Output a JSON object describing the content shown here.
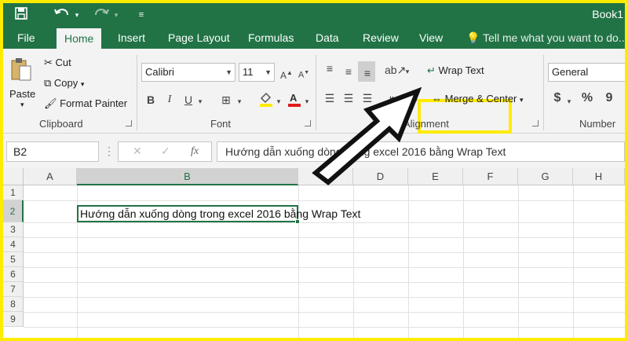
{
  "app": {
    "book_title": "Book1"
  },
  "qat": {
    "save": "save-icon",
    "undo": "undo-icon",
    "redo": "redo-icon",
    "customize": "customize-icon"
  },
  "tabs": [
    "File",
    "Home",
    "Insert",
    "Page Layout",
    "Formulas",
    "Data",
    "Review",
    "View"
  ],
  "tellme": "Tell me what you want to do...",
  "clipboard": {
    "paste": "Paste",
    "cut": "Cut",
    "copy": "Copy",
    "format_painter": "Format Painter",
    "label": "Clipboard"
  },
  "font": {
    "name": "Calibri",
    "size": "11",
    "label": "Font",
    "bold": "B",
    "italic": "I",
    "underline": "U",
    "fill_icon": "fill-color-icon",
    "font_color_icon": "font-color-icon",
    "borders_icon": "borders-icon"
  },
  "alignment": {
    "wrap_text": "Wrap Text",
    "merge_center": "Merge & Center",
    "label": "Alignment"
  },
  "number": {
    "format": "General",
    "label": "Number",
    "currency": "$",
    "percent": "%",
    "comma": "9"
  },
  "formula_bar": {
    "name_box": "B2",
    "fx": "fx",
    "content": "Hướng dẫn xuống dòng trong excel 2016 bằng Wrap Text"
  },
  "grid": {
    "columns": [
      "A",
      "B",
      "C",
      "D",
      "E",
      "F",
      "G",
      "H"
    ],
    "rows": [
      "1",
      "2",
      "3",
      "4",
      "5",
      "6",
      "7",
      "8",
      "9"
    ],
    "selected_cell": "B2",
    "b2_value": "Hướng dẫn xuống dòng trong excel 2016 bằng Wrap Text"
  },
  "colors": {
    "excel_green": "#217346",
    "highlight_yellow": "#ffeb00"
  }
}
